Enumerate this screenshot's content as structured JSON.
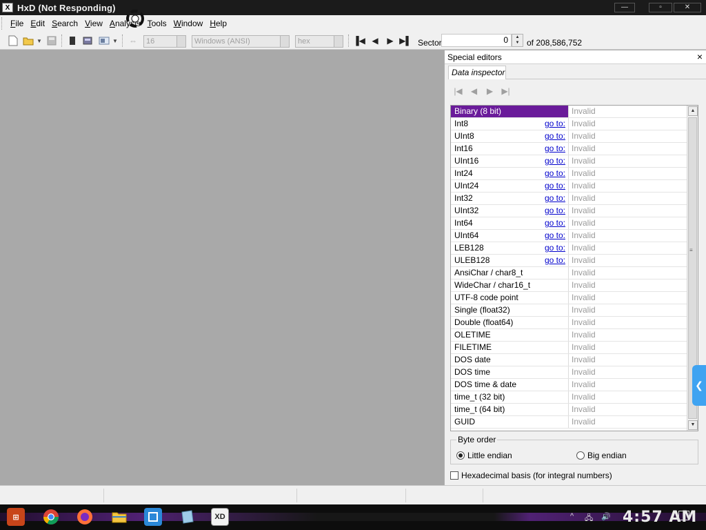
{
  "window": {
    "app_icon_text": "X",
    "title": "HxD (Not Responding)",
    "min_glyph": "—",
    "max_glyph": "▫",
    "close_glyph": "✕"
  },
  "menu": {
    "items": [
      {
        "label_u": "F",
        "label_rest": "ile"
      },
      {
        "label_u": "E",
        "label_rest": "dit"
      },
      {
        "label_u": "S",
        "label_rest": "earch"
      },
      {
        "label_u": "V",
        "label_rest": "iew"
      },
      {
        "label_u": "A",
        "label_rest": "nalysis"
      },
      {
        "label_u": "T",
        "label_rest": "ools"
      },
      {
        "label_u": "W",
        "label_rest": "indow"
      },
      {
        "label_u": "H",
        "label_rest": "elp"
      }
    ]
  },
  "toolbar": {
    "bytes_per_row": "16",
    "charset": "Windows (ANSI)",
    "offset_base": "hex",
    "sector_label": "Sector",
    "sector_value": "0",
    "sector_total": "of 208,586,752"
  },
  "panel": {
    "header": "Special editors",
    "close_glyph": "×",
    "tab": "Data inspector",
    "rows": [
      {
        "name": "Binary (8 bit)",
        "goto": "",
        "value": "Invalid"
      },
      {
        "name": "Int8",
        "goto": "go to:",
        "value": "Invalid"
      },
      {
        "name": "UInt8",
        "goto": "go to:",
        "value": "Invalid"
      },
      {
        "name": "Int16",
        "goto": "go to:",
        "value": "Invalid"
      },
      {
        "name": "UInt16",
        "goto": "go to:",
        "value": "Invalid"
      },
      {
        "name": "Int24",
        "goto": "go to:",
        "value": "Invalid"
      },
      {
        "name": "UInt24",
        "goto": "go to:",
        "value": "Invalid"
      },
      {
        "name": "Int32",
        "goto": "go to:",
        "value": "Invalid"
      },
      {
        "name": "UInt32",
        "goto": "go to:",
        "value": "Invalid"
      },
      {
        "name": "Int64",
        "goto": "go to:",
        "value": "Invalid"
      },
      {
        "name": "UInt64",
        "goto": "go to:",
        "value": "Invalid"
      },
      {
        "name": "LEB128",
        "goto": "go to:",
        "value": "Invalid"
      },
      {
        "name": "ULEB128",
        "goto": "go to:",
        "value": "Invalid"
      },
      {
        "name": "AnsiChar / char8_t",
        "goto": "",
        "value": "Invalid"
      },
      {
        "name": "WideChar / char16_t",
        "goto": "",
        "value": "Invalid"
      },
      {
        "name": "UTF-8 code point",
        "goto": "",
        "value": "Invalid"
      },
      {
        "name": "Single (float32)",
        "goto": "",
        "value": "Invalid"
      },
      {
        "name": "Double (float64)",
        "goto": "",
        "value": "Invalid"
      },
      {
        "name": "OLETIME",
        "goto": "",
        "value": "Invalid"
      },
      {
        "name": "FILETIME",
        "goto": "",
        "value": "Invalid"
      },
      {
        "name": "DOS date",
        "goto": "",
        "value": "Invalid"
      },
      {
        "name": "DOS time",
        "goto": "",
        "value": "Invalid"
      },
      {
        "name": "DOS time & date",
        "goto": "",
        "value": "Invalid"
      },
      {
        "name": "time_t (32 bit)",
        "goto": "",
        "value": "Invalid"
      },
      {
        "name": "time_t (64 bit)",
        "goto": "",
        "value": "Invalid"
      },
      {
        "name": "GUID",
        "goto": "",
        "value": "Invalid"
      }
    ],
    "selected_row_color": "#6a1b9a",
    "byte_order_label": "Byte order",
    "little_endian": "Little endian",
    "big_endian": "Big endian",
    "selected_byte_order": "little",
    "hex_basis_label": "Hexadecimal basis (for integral numbers)"
  },
  "taskbar": {
    "clock": "4:57 AM",
    "apps": [
      "start",
      "chrome",
      "firefox",
      "file-explorer",
      "window-switcher",
      "notepad",
      "hxd"
    ]
  },
  "colors": {
    "accent_side_tab": "#3fa3f1",
    "link": "#0000cc"
  }
}
